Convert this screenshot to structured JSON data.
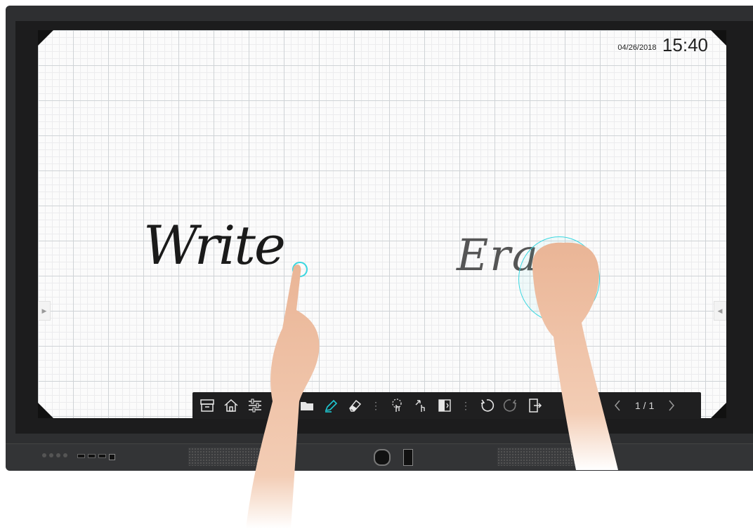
{
  "status": {
    "date": "04/26/2018",
    "time": "15:40"
  },
  "canvas": {
    "written_word": "Write",
    "erased_word": "Erase"
  },
  "toolbar": {
    "left_tools": [
      "archive-icon",
      "home-icon",
      "sliders-icon",
      "folder-icon",
      "pen-icon",
      "eraser-icon"
    ],
    "middle_tools": [
      "select-icon",
      "resize-icon",
      "split-icon"
    ],
    "history_tools": [
      "undo-icon",
      "redo-icon",
      "exit-icon"
    ],
    "page_indicator": "1 / 1",
    "add_page": "+",
    "pen_active_color": "#1ec8d2"
  },
  "colors": {
    "bezel": "#2e2f31",
    "toolbar": "#1f1f20",
    "touch_ring": "#3ad7e0"
  }
}
